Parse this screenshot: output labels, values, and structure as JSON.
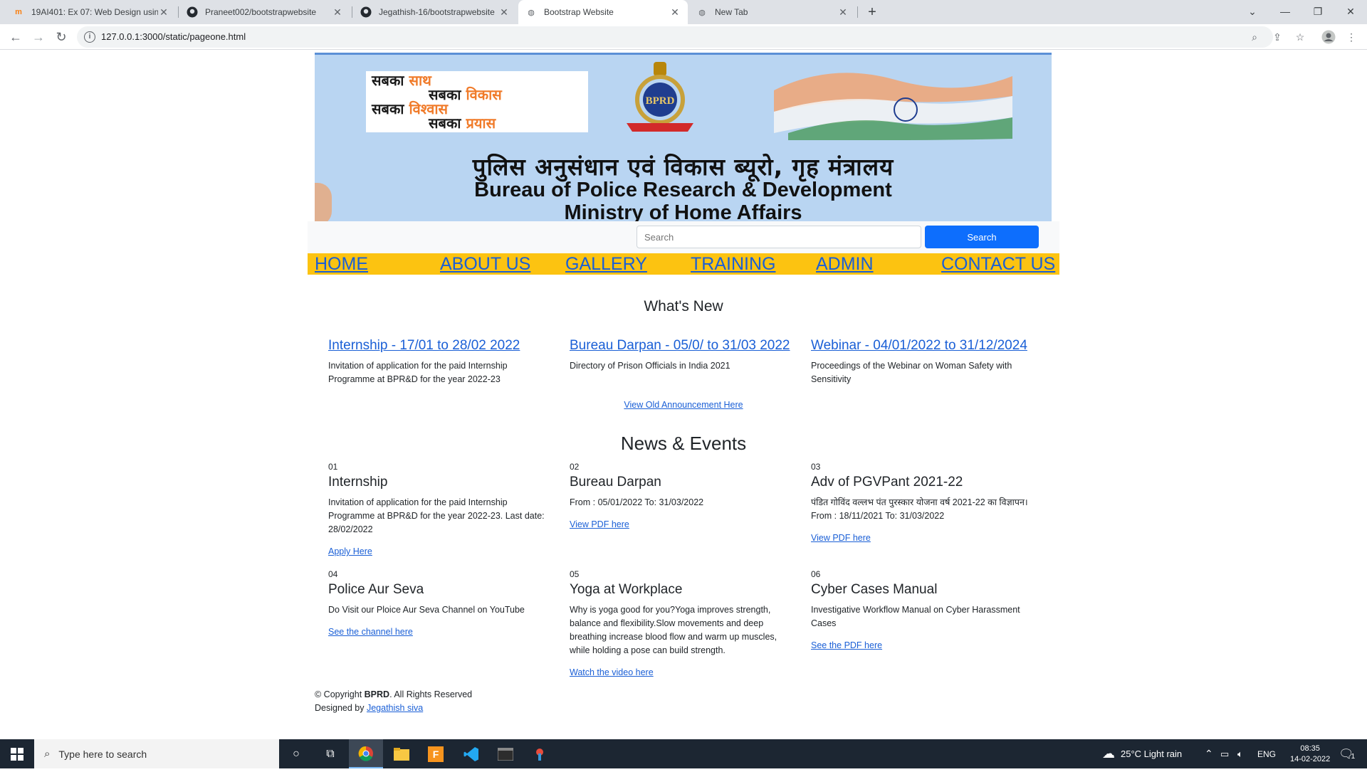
{
  "browser": {
    "tabs": [
      {
        "title": "19AI401: Ex 07: Web Design usin",
        "favicon": "moodle-icon"
      },
      {
        "title": "Praneet002/bootstrapwebsite",
        "favicon": "github-icon"
      },
      {
        "title": "Jegathish-16/bootstrapwebsite",
        "favicon": "github-icon"
      },
      {
        "title": "Bootstrap Website",
        "favicon": "globe-icon"
      },
      {
        "title": "New Tab",
        "favicon": "globe-icon"
      }
    ],
    "url": "127.0.0.1:3000/static/pageone.html"
  },
  "banner": {
    "slogan": {
      "l1a": "सबका ",
      "l1b": "साथ",
      "l2a": "सबका ",
      "l2b": "विकास",
      "l3a": "सबका ",
      "l3b": "विश्वास",
      "l4a": "सबका ",
      "l4b": "प्रयास"
    },
    "emblem_text": "BPRD",
    "hindi_title": "पुलिस अनुसंधान एवं विकास ब्यूरो, गृह मंत्रालय",
    "english_line1": "Bureau of Police Research & Development",
    "english_line2": "Ministry of Home Affairs"
  },
  "search": {
    "placeholder": "Search",
    "button_label": "Search"
  },
  "nav": {
    "home": "HOME",
    "about": "ABOUT US",
    "gallery": "GALLERY",
    "training": "TRAINING",
    "admin": "ADMIN",
    "contact": "CONTACT US"
  },
  "whats_new": {
    "title": "What's New",
    "items": [
      {
        "heading": "Internship - 17/01 to 28/02 2022",
        "text": "Invitation of application for the paid Internship Programme at BPR&D for the year 2022-23"
      },
      {
        "heading": "Bureau Darpan - 05/0/ to 31/03 2022",
        "text": "Directory of Prison Officials in India 2021"
      },
      {
        "heading": "Webinar - 04/01/2022 to 31/12/2024",
        "text": "Proceedings of the Webinar on Woman Safety with Sensitivity"
      }
    ],
    "old_link": "View Old Announcement Here"
  },
  "news": {
    "title": "News & Events",
    "items": [
      {
        "num": "01",
        "heading": "Internship",
        "text": "Invitation of application for the paid Internship Programme at BPR&D for the year 2022-23. Last date: 28/02/2022",
        "link": "Apply Here"
      },
      {
        "num": "02",
        "heading": "Bureau Darpan",
        "text": "From : 05/01/2022 To: 31/03/2022",
        "link": "View PDF here"
      },
      {
        "num": "03",
        "heading": "Adv of PGVPant 2021-22",
        "text": "पंडित गोविंद वल्लभ पंत पुरस्कार योजना वर्ष 2021-22 का विज्ञापन। From : 18/11/2021 To: 31/03/2022",
        "link": "View PDF here"
      },
      {
        "num": "04",
        "heading": "Police Aur Seva",
        "text": "Do Visit our Ploice Aur Seva Channel on YouTube",
        "link": "See the channel here"
      },
      {
        "num": "05",
        "heading": "Yoga at Workplace",
        "text": "Why is yoga good for you?Yoga improves strength, balance and flexibility.Slow movements and deep breathing increase blood flow and warm up muscles, while holding a pose can build strength.",
        "link": "Watch the video here"
      },
      {
        "num": "06",
        "heading": "Cyber Cases Manual",
        "text": "Investigative Workflow Manual on Cyber Harassment Cases",
        "link": "See the PDF here"
      }
    ]
  },
  "footer": {
    "copyright_prefix": "© Copyright ",
    "brand": "BPRD",
    "copyright_suffix": ". All Rights Reserved",
    "designed_by": "Designed by ",
    "designer": "Jegathish siva"
  },
  "taskbar": {
    "search_placeholder": "Type here to search",
    "weather": "25°C  Light rain",
    "lang": "ENG",
    "time": "08:35",
    "date": "14-02-2022",
    "notif_count": "1"
  },
  "colors": {
    "nav_bg": "#fcc311",
    "link": "#1a5fd6",
    "search_button": "#0d6efd",
    "banner_bg": "#b9d5f2"
  }
}
